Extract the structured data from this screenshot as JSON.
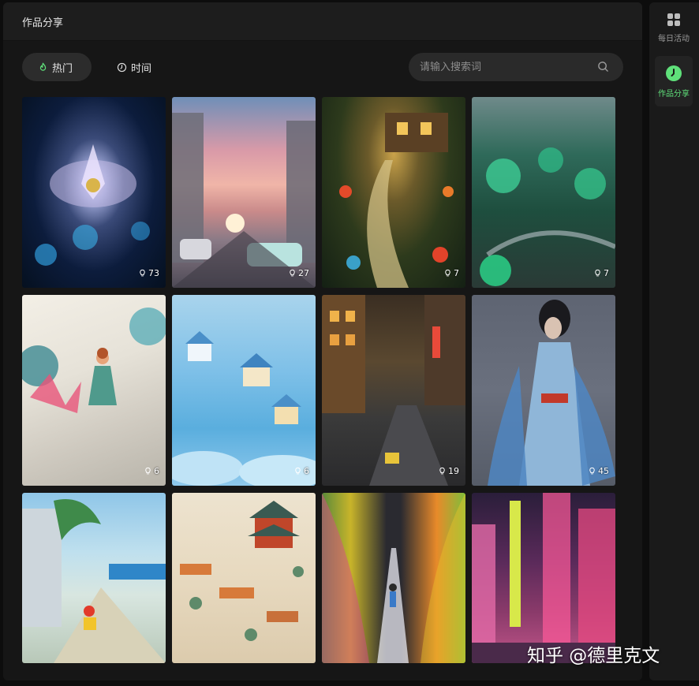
{
  "panel": {
    "title": "作品分享"
  },
  "tabs": [
    {
      "label": "热门",
      "icon": "fire-icon",
      "active": true
    },
    {
      "label": "时间",
      "icon": "clock-icon",
      "active": false
    }
  ],
  "search": {
    "placeholder": "请输入搜索词",
    "value": ""
  },
  "sidebar": {
    "items": [
      {
        "label": "每日活动",
        "icon": "grid-icon",
        "active": false
      },
      {
        "label": "作品分享",
        "icon": "clock-icon",
        "active": true
      }
    ]
  },
  "gallery": [
    {
      "likes": "73",
      "icon": "lightbulb-icon"
    },
    {
      "likes": "27",
      "icon": "lightbulb-icon"
    },
    {
      "likes": "7",
      "icon": "lightbulb-icon"
    },
    {
      "likes": "7",
      "icon": "lightbulb-icon"
    },
    {
      "likes": "6",
      "icon": "lightbulb-icon"
    },
    {
      "likes": "6",
      "icon": "lightbulb-icon"
    },
    {
      "likes": "19",
      "icon": "lightbulb-icon"
    },
    {
      "likes": "45",
      "icon": "lightbulb-icon"
    },
    {
      "likes": "",
      "icon": ""
    },
    {
      "likes": "",
      "icon": ""
    },
    {
      "likes": "",
      "icon": ""
    },
    {
      "likes": "",
      "icon": ""
    }
  ],
  "watermark": "知乎 @德里克文",
  "colors": {
    "accent": "#5fe07a",
    "background": "#161616",
    "header": "#1d1d1d"
  }
}
